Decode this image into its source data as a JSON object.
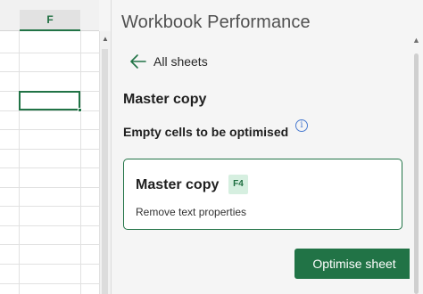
{
  "grid": {
    "column_header": "F"
  },
  "pane": {
    "title": "Workbook Performance",
    "back_label": "All sheets",
    "sheet_name": "Master copy",
    "subheading": "Empty cells to be optimised",
    "info_icon": "i",
    "card": {
      "title": "Master copy",
      "cell_badge": "F4",
      "description": "Remove text properties"
    },
    "action_button": "Optimise sheet"
  },
  "icons": {
    "back": "left-arrow-icon",
    "info": "info-icon"
  },
  "colors": {
    "accent": "#217346",
    "badge_bg": "#d6efe0",
    "pane_bg": "#f5f5f5"
  }
}
